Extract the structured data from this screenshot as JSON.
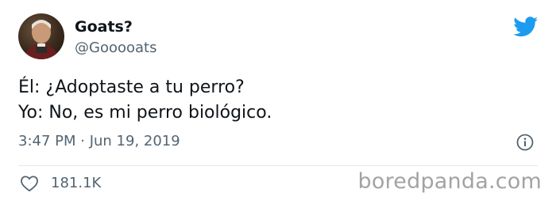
{
  "author": {
    "display_name": "Goats?",
    "handle": "@Gooooats"
  },
  "tweet": {
    "lines": [
      "Él: ¿Adoptaste a tu perro?",
      "Yo: No, es mi perro biológico."
    ],
    "timestamp": "3:47 PM · Jun 19, 2019"
  },
  "engagement": {
    "likes": "181.1K"
  },
  "watermark": "boredpanda.com",
  "colors": {
    "twitter_blue": "#1d9bf0",
    "secondary_text": "#536471",
    "primary_text": "#0f1419"
  },
  "icons": {
    "brand": "twitter-bird-icon",
    "info": "info-icon",
    "like": "heart-icon"
  }
}
